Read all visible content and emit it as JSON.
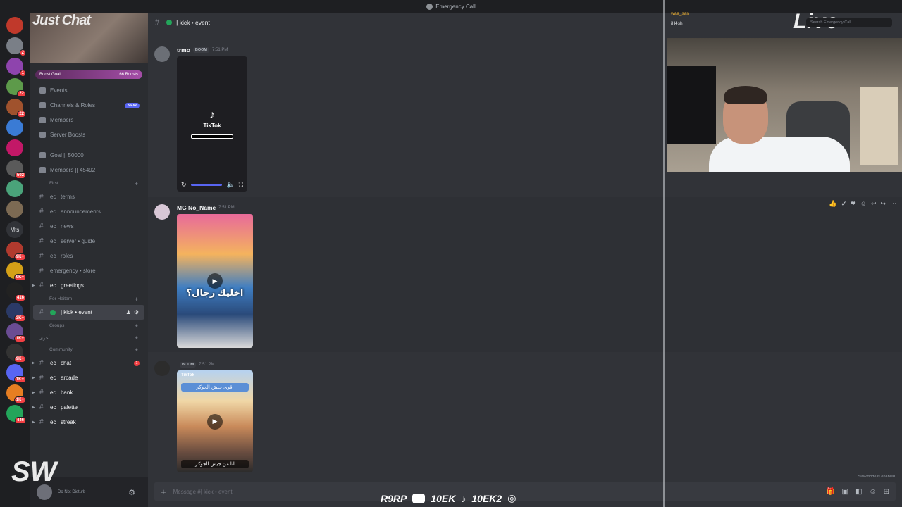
{
  "window": {
    "title": "Emergency Call"
  },
  "guilds": [
    {
      "color": "#c0392b",
      "badge": ""
    },
    {
      "color": "#7a7f87",
      "badge": "2"
    },
    {
      "color": "#8e44ad",
      "badge": "1"
    },
    {
      "color": "#5d9a4a",
      "badge": "22"
    },
    {
      "color": "#a0522d",
      "badge": "22"
    },
    {
      "color": "#3a7bd5",
      "badge": ""
    },
    {
      "color": "#c21867",
      "badge": ""
    },
    {
      "color": "#5a5a5a",
      "badge": "502"
    },
    {
      "color": "#4aa37a",
      "badge": ""
    },
    {
      "color": "#7c6a53",
      "badge": ""
    },
    {
      "text": "Mts",
      "badge": ""
    },
    {
      "color": "#b03a2e",
      "badge": "9K+"
    },
    {
      "color": "#d4a017",
      "badge": "9K+"
    },
    {
      "color": "#222222",
      "badge": "416"
    },
    {
      "color": "#2b3a67",
      "badge": "3K+"
    },
    {
      "color": "#6a4c93",
      "badge": "1K+"
    },
    {
      "color": "#333333",
      "badge": "9K+"
    },
    {
      "color": "#5865f2",
      "badge": "1K+"
    },
    {
      "color": "#e67e22",
      "badge": "1K+"
    },
    {
      "color": "#23a55a",
      "badge": "446"
    }
  ],
  "server": {
    "banner_tag": "Just Chat",
    "boost_goal": "Boost Goal",
    "boost_count": "66 Boosts"
  },
  "menu": [
    {
      "label": "Events",
      "icon": "calendar-icon",
      "badge": ""
    },
    {
      "label": "Channels & Roles",
      "icon": "channels-icon",
      "badge": "NEW"
    },
    {
      "label": "Members",
      "icon": "members-icon",
      "badge": ""
    },
    {
      "label": "Server Boosts",
      "icon": "boost-icon",
      "badge": ""
    }
  ],
  "stats": [
    {
      "label": "Goal || 50000"
    },
    {
      "label": "Members || 45492"
    }
  ],
  "categories": {
    "first": "First",
    "for_haitam": "For Haitam",
    "groups": "Groups",
    "arabic": "أخرى",
    "community": "Community"
  },
  "first_channels": [
    {
      "name": "ec | terms"
    },
    {
      "name": "ec | announcements"
    },
    {
      "name": "ec | news"
    },
    {
      "name": "ec | server • guide"
    },
    {
      "name": "ec | roles"
    },
    {
      "name": "emergency • store"
    }
  ],
  "greetings_channel": "ec | greetings",
  "active_channel": "| kick • event",
  "community_channels": [
    {
      "name": "ec | chat",
      "unread": "1"
    },
    {
      "name": "ec | arcade",
      "unread": ""
    },
    {
      "name": "ec | bank",
      "unread": ""
    },
    {
      "name": "ec | palette",
      "unread": ""
    },
    {
      "name": "ec | streak",
      "unread": ""
    }
  ],
  "user": {
    "status": "Do Not Disturb"
  },
  "channel_header": {
    "name": "| kick • event"
  },
  "messages": [
    {
      "author": "trmo",
      "tag": "BOOM",
      "time": "7:51 PM",
      "media_label": "TikTok"
    },
    {
      "author": "MG No_Name",
      "tag": "",
      "time": "7:51 PM",
      "overlay": "اخليك رجال؟"
    },
    {
      "author": "",
      "tag": "BOOM",
      "time": "7:51 PM",
      "media_label": "TikTok",
      "caption_top": "اقوى جيش الجوكر",
      "caption_bottom": "انا من جيش الجوكر"
    }
  ],
  "composer": {
    "placeholder": "Message #| kick • event"
  },
  "slowmode": "Slowmode is enabled",
  "stream": {
    "voice_users": [
      "waa_san",
      "iH4sh"
    ],
    "search_placeholder": "Search Emergency Call",
    "live_label": "Live"
  },
  "overlay": {
    "socials": [
      "R9RP",
      "10EK",
      "10EK2"
    ],
    "corner_logo": "SW"
  }
}
